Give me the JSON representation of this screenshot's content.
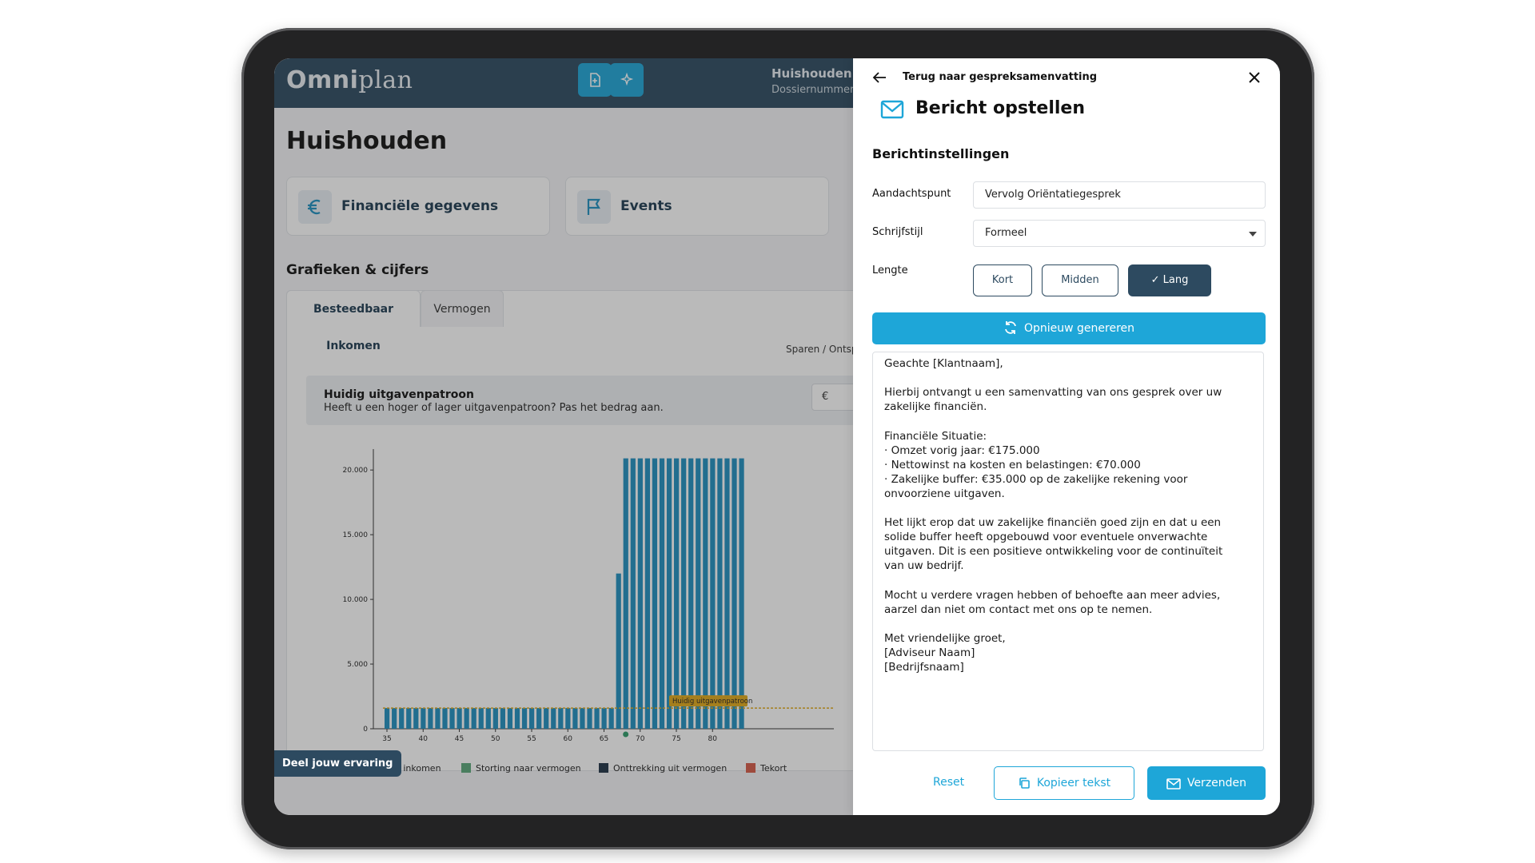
{
  "app": {
    "logo_bold": "Omni",
    "logo_rest": "plan",
    "household_name": "Huishouden A",
    "dossier_label": "Dossiernummer",
    "page_title": "Huishouden",
    "cards": [
      {
        "label": "Financiële gegevens",
        "icon": "euro-icon"
      },
      {
        "label": "Events",
        "icon": "flag-icon"
      }
    ],
    "section_title": "Grafieken & cijfers",
    "tabs": [
      "Besteedbaar Inkomen",
      "Vermogen"
    ],
    "sparen_label": "Sparen / Ontsp",
    "notice": {
      "title": "Huidig uitgavenpatroon",
      "text": "Heeft u een hoger of lager uitgavenpatroon? Pas het bedrag aan.",
      "currency": "€"
    },
    "share_button": "Deel jouw ervaring"
  },
  "chart_data": {
    "type": "bar",
    "x": [
      35,
      36,
      37,
      38,
      39,
      40,
      41,
      42,
      43,
      44,
      45,
      46,
      47,
      48,
      49,
      50,
      51,
      52,
      53,
      54,
      55,
      56,
      57,
      58,
      59,
      60,
      61,
      62,
      63,
      64,
      65,
      66,
      67,
      68,
      69,
      70,
      71,
      72,
      73,
      74,
      75,
      76,
      77,
      78,
      79,
      80,
      81,
      82,
      83,
      84
    ],
    "xticks": [
      "35",
      "40",
      "45",
      "50",
      "55",
      "60",
      "65",
      "70",
      "75",
      "80"
    ],
    "yticks": [
      "0",
      "5.000",
      "10.000",
      "15.000",
      "20.000"
    ],
    "ylim": [
      0,
      21000
    ],
    "series": [
      {
        "name": "Besteedbaar inkomen",
        "color": "#1f8fc0",
        "values": [
          1600,
          1600,
          1600,
          1600,
          1600,
          1600,
          1600,
          1600,
          1600,
          1600,
          1600,
          1600,
          1600,
          1600,
          1600,
          1600,
          1600,
          1600,
          1600,
          1600,
          1600,
          1600,
          1600,
          1600,
          1600,
          1600,
          1600,
          1600,
          1600,
          1600,
          1600,
          1600,
          12000,
          20900,
          20900,
          20900,
          20900,
          20900,
          20900,
          20900,
          20900,
          20900,
          20900,
          20900,
          20900,
          20900,
          20900,
          20900,
          20900,
          20900
        ]
      },
      {
        "name": "Storting naar vermogen",
        "color": "#5aa77a",
        "values": []
      },
      {
        "name": "Onttrekking uit vermogen",
        "color": "#1f3346",
        "values": []
      },
      {
        "name": "Tekort",
        "color": "#d65a48",
        "values": []
      }
    ],
    "reference_line": {
      "label": "Huidig uitgavenpatroon",
      "value": 1600,
      "color": "#e0a818"
    },
    "marker_age": 68
  },
  "drawer": {
    "back_label": "Terug naar gespreksamenvatting",
    "title": "Bericht opstellen",
    "subtitle": "Berichtinstellingen",
    "fields": {
      "aandachtspunt_label": "Aandachtspunt",
      "aandachtspunt_value": "Vervolg Oriëntatiegesprek",
      "schrijfstijl_label": "Schrijfstijl",
      "schrijfstijl_value": "Formeel",
      "lengte_label": "Lengte"
    },
    "lengths": [
      "Kort",
      "Midden",
      "✓ Lang"
    ],
    "regen_label": "Opnieuw genereren",
    "message_lines": [
      "Geachte [Klantnaam],",
      "",
      "Hierbij ontvangt u een samenvatting van ons gesprek over uw",
      "zakelijke financiën.",
      "",
      "Financiële Situatie:",
      "· Omzet vorig jaar: €175.000",
      "· Nettowinst na kosten en belastingen: €70.000",
      "· Zakelijke buffer: €35.000 op de zakelijke rekening voor",
      "onvoorziene uitgaven.",
      "",
      "Het lijkt erop dat uw zakelijke financiën goed zijn en dat u een",
      "solide buffer heeft opgebouwd voor eventuele onverwachte",
      "uitgaven. Dit is een positieve ontwikkeling voor de continuïteit",
      "van uw bedrijf.",
      "",
      "Mocht u verdere vragen hebben of behoefte aan meer advies,",
      "aarzel dan niet om contact met ons op te nemen.",
      "",
      "Met vriendelijke groet,",
      "[Adviseur Naam]",
      "[Bedrijfsnaam]"
    ],
    "reset_label": "Reset",
    "copy_label": "Kopieer tekst",
    "send_label": "Verzenden"
  }
}
